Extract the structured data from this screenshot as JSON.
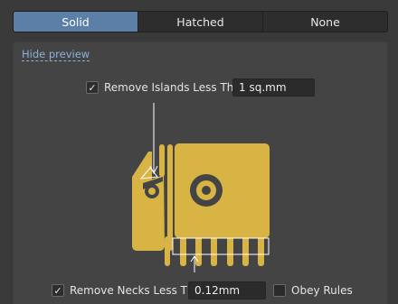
{
  "fill_mode": {
    "options": [
      "Solid",
      "Hatched",
      "None"
    ],
    "selected": "Solid"
  },
  "preview": {
    "hide_link": "Hide preview"
  },
  "remove_islands": {
    "checked": true,
    "label": "Remove Islands Less Than",
    "value": "1 sq.mm"
  },
  "remove_necks": {
    "checked": true,
    "label": "Remove Necks Less Than",
    "value": "0.12mm"
  },
  "obey_rules": {
    "checked": false,
    "label": "Obey Rules"
  },
  "colors": {
    "accent": "#5b7fa6",
    "copper": "#d8b444",
    "link": "#8fb1d9"
  }
}
